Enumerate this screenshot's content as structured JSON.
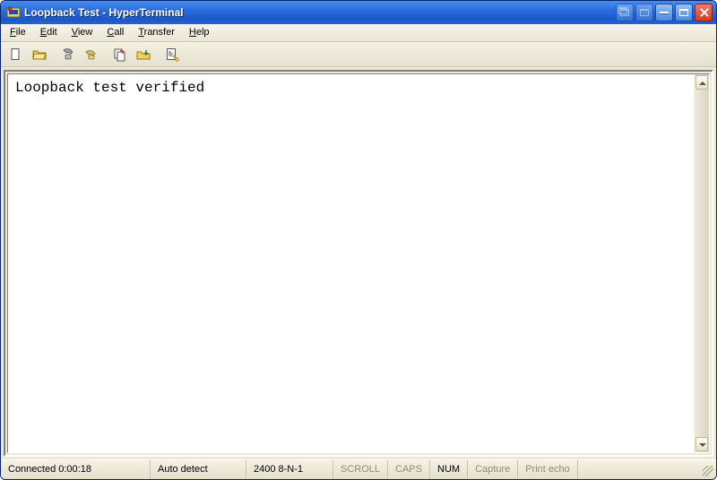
{
  "window": {
    "title": "Loopback Test - HyperTerminal",
    "app_icon": "hyperterminal-icon"
  },
  "title_buttons": {
    "restore_down": "restore-icon",
    "restore_down_enabled": false,
    "maximize": "maximize-icon",
    "maximize_enabled": false,
    "minimize": "minimize-icon",
    "maximize2": "maximize-icon",
    "close": "close-icon"
  },
  "menu": {
    "items": [
      "File",
      "Edit",
      "View",
      "Call",
      "Transfer",
      "Help"
    ]
  },
  "toolbar": {
    "buttons": [
      {
        "id": "new",
        "icon": "new-file-icon"
      },
      {
        "id": "open",
        "icon": "open-folder-icon"
      },
      {
        "id": "connect",
        "icon": "telephone-connect-icon"
      },
      {
        "id": "disconnect",
        "icon": "telephone-disconnect-icon"
      },
      {
        "id": "send",
        "icon": "send-icon"
      },
      {
        "id": "receive",
        "icon": "receive-icon"
      },
      {
        "id": "properties",
        "icon": "properties-icon"
      }
    ]
  },
  "terminal": {
    "content": "Loopback test verified"
  },
  "status": {
    "connected": "Connected 0:00:18",
    "detect": "Auto detect",
    "port_settings": "2400 8-N-1",
    "scroll": "SCROLL",
    "caps": "CAPS",
    "num": "NUM",
    "capture": "Capture",
    "print_echo": "Print echo"
  }
}
